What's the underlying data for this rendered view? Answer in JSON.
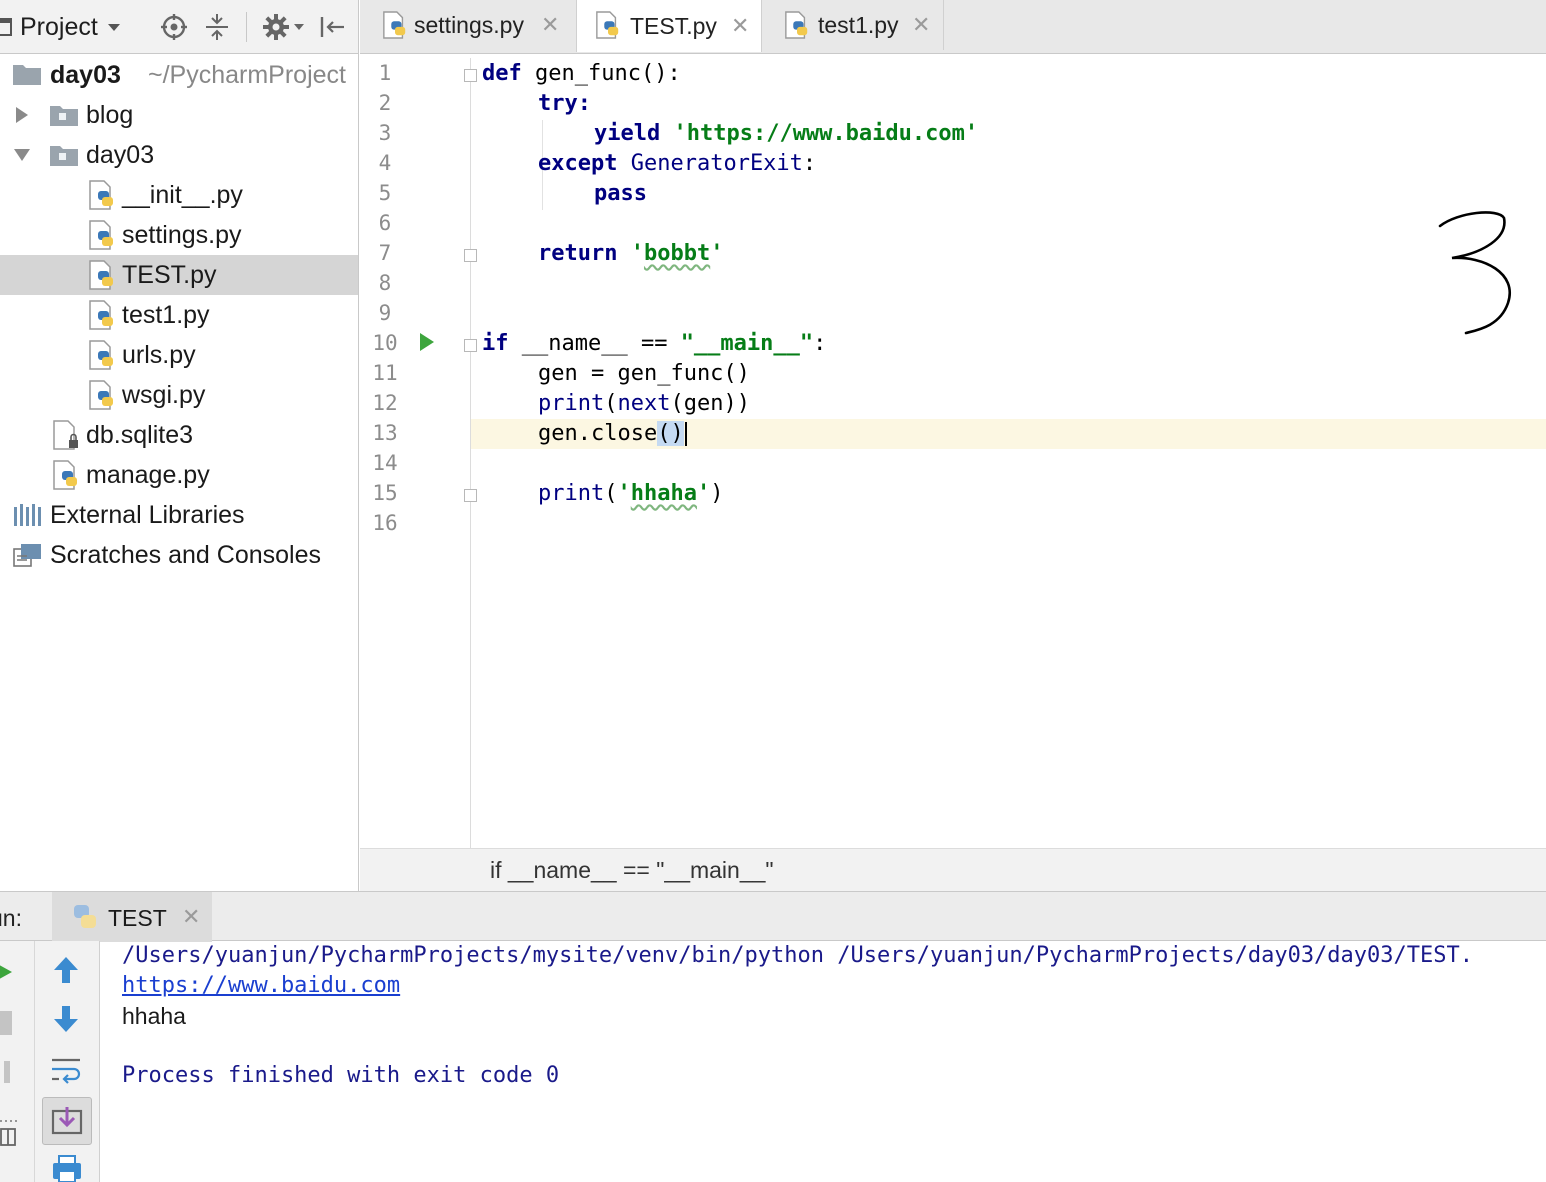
{
  "sidebar": {
    "toolbar": {
      "project_label": "Project"
    },
    "tree": [
      {
        "label": "day03",
        "suffix": "~/PycharmProject",
        "kind": "root-folder"
      },
      {
        "label": "blog",
        "kind": "folder-collapsed"
      },
      {
        "label": "day03",
        "kind": "folder-expanded"
      },
      {
        "label": "__init__.py",
        "kind": "python-file"
      },
      {
        "label": "settings.py",
        "kind": "python-file"
      },
      {
        "label": "TEST.py",
        "kind": "python-file",
        "selected": true
      },
      {
        "label": "test1.py",
        "kind": "python-file"
      },
      {
        "label": "urls.py",
        "kind": "python-file"
      },
      {
        "label": "wsgi.py",
        "kind": "python-file"
      },
      {
        "label": "db.sqlite3",
        "kind": "database-file"
      },
      {
        "label": "manage.py",
        "kind": "python-file"
      },
      {
        "label": "External Libraries",
        "kind": "libraries"
      },
      {
        "label": "Scratches and Consoles",
        "kind": "scratches"
      }
    ]
  },
  "tabs": [
    {
      "label": "settings.py",
      "active": false
    },
    {
      "label": "TEST.py",
      "active": true
    },
    {
      "label": "test1.py",
      "active": false
    }
  ],
  "editor": {
    "line_numbers": [
      "1",
      "2",
      "3",
      "4",
      "5",
      "6",
      "7",
      "8",
      "9",
      "10",
      "11",
      "12",
      "13",
      "14",
      "15",
      "16"
    ],
    "current_line": 13,
    "code": {
      "l1_kw": "def",
      "l1_rest": " gen_func():",
      "l2_kw": "try",
      "l3_kw": "yield",
      "l3_str": "'https://www.baidu.com'",
      "l4_kw": "except",
      "l4_cls": "GeneratorExit",
      "l5_kw": "pass",
      "l7_kw": "return",
      "l7_q1": "'",
      "l7_str": "bobbt",
      "l7_q2": "'",
      "l10_kw": "if",
      "l10_mid": " __name__ == ",
      "l10_str": "\"__main__\"",
      "l11": "gen = gen_func()",
      "l12_bi": "print",
      "l12_p": "(",
      "l12_bi2": "next",
      "l12_rest": "(gen))",
      "l13_pre": "gen.close",
      "l13_paren": "()",
      "l15_bi": "print",
      "l15_p": "(",
      "l15_q1": "'",
      "l15_str": "hhaha",
      "l15_q2": "'",
      "l15_close": ")"
    },
    "handwritten_annotation": "3",
    "breadcrumb": "if __name__ == \"__main__\""
  },
  "run": {
    "label": "un:",
    "tab_label": "TEST",
    "console": {
      "command": "/Users/yuanjun/PycharmProjects/mysite/venv/bin/python /Users/yuanjun/PycharmProjects/day03/day03/TEST.",
      "link": "https://www.baidu.com",
      "output": "hhaha",
      "exit": "Process finished with exit code 0"
    }
  },
  "colors": {
    "keyword": "#000080",
    "string": "#067d17",
    "selected_row": "#d5d5d5",
    "current_line": "#fcf7e2",
    "run_green": "#3da53d",
    "arrow_blue": "#3b8bd0"
  }
}
